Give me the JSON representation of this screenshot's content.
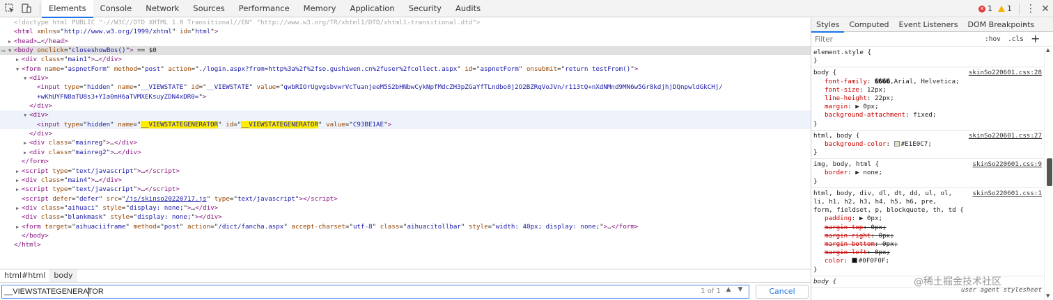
{
  "toolbar": {
    "tabs": [
      "Elements",
      "Console",
      "Network",
      "Sources",
      "Performance",
      "Memory",
      "Application",
      "Security",
      "Audits"
    ],
    "active_tab": "Elements",
    "error_count": "1",
    "warning_count": "1"
  },
  "dom_lines": [
    {
      "indent": 0,
      "tri": "",
      "html": "<span class='cm'>&lt;!doctype html PUBLIC \"-//W3C//DTD XHTML 1.0 Transitional//EN\" \"http://www.w3.org/TR/xhtml1/DTD/xhtml1-transitional.dtd\"&gt;</span>"
    },
    {
      "indent": 0,
      "tri": "",
      "html": "<span class='tn'>&lt;html</span> <span class='an'>xmlns</span>=\"<span class='av'>http://www.w3.org/1999/xhtml</span>\" <span class='an'>id</span>=\"<span class='av'>html</span>\"<span class='tn'>&gt;</span>"
    },
    {
      "indent": 0,
      "tri": "▶",
      "html": "<span class='tn'>&lt;head&gt;</span>…<span class='tn'>&lt;/head&gt;</span>"
    },
    {
      "indent": 0,
      "tri": "▼",
      "sel": true,
      "html": "<span class='tn'>&lt;body</span> <span class='an'>onclick</span>=\"<span class='av'>closeshowBos()</span>\"<span class='tn'>&gt;</span> == $0"
    },
    {
      "indent": 1,
      "tri": "▶",
      "html": "<span class='tn'>&lt;div</span> <span class='an'>class</span>=\"<span class='av'>main1</span>\"<span class='tn'>&gt;</span>…<span class='tn'>&lt;/div&gt;</span>"
    },
    {
      "indent": 1,
      "tri": "▼",
      "html": "<span class='tn'>&lt;form</span> <span class='an'>name</span>=\"<span class='av'>aspnetForm</span>\" <span class='an'>method</span>=\"<span class='av'>post</span>\" <span class='an'>action</span>=\"<span class='av'>./login.aspx?from=http%3a%2f%2fso.gushiwen.cn%2fuser%2fcollect.aspx</span>\" <span class='an'>id</span>=\"<span class='av'>aspnetForm</span>\" <span class='an'>onsubmit</span>=\"<span class='av'>return testFrom()</span>\"<span class='tn'>&gt;</span>"
    },
    {
      "indent": 2,
      "tri": "▼",
      "html": "<span class='tn'>&lt;div&gt;</span>"
    },
    {
      "indent": 3,
      "tri": "",
      "html": "<span class='tn'>&lt;input</span> <span class='an'>type</span>=\"<span class='av'>hidden</span>\" <span class='an'>name</span>=\"<span class='av'>__VIEWSTATE</span>\" <span class='an'>id</span>=\"<span class='av'>__VIEWSTATE</span>\" <span class='an'>value</span>=\"<span class='av'>qwbRIOrUgvgsbvwrVcTuanjeeM5S2bHNbwCykNpfMdcZH3pZGaYfTLndbo8j2O2BZRqVoJVn/r113tQ+nXdNMnd9MN6w5Gr8kdjhjDQnpwldGkCHj/</span>"
    },
    {
      "indent": 3,
      "tri": "",
      "html": "<span class='av'>+wKhUYFN8aTU8s3+YIa0nH6aTVMXEKsuyZDN4xDR0=</span>\"<span class='tn'>&gt;</span>"
    },
    {
      "indent": 2,
      "tri": "",
      "html": "<span class='tn'>&lt;/div&gt;</span>"
    },
    {
      "indent": 2,
      "tri": "▼",
      "hl": true,
      "html": "<span class='tn'>&lt;div&gt;</span>"
    },
    {
      "indent": 3,
      "tri": "",
      "hl": true,
      "html": "<span class='tn'>&lt;input</span> <span class='an'>type</span>=\"<span class='av'>hidden</span>\" <span class='an'>name</span>=\"<span class='av hlt'>__VIEWSTATEGENERATOR</span>\" <span class='an'>id</span>=\"<span class='av hlt'>__VIEWSTATEGENERATOR</span>\" <span class='an'>value</span>=\"<span class='av'>C93BE1AE</span>\"<span class='tn'>&gt;</span>"
    },
    {
      "indent": 2,
      "tri": "",
      "html": "<span class='tn'>&lt;/div&gt;</span>"
    },
    {
      "indent": 2,
      "tri": "▶",
      "html": "<span class='tn'>&lt;div</span> <span class='an'>class</span>=\"<span class='av'>mainreg</span>\"<span class='tn'>&gt;</span>…<span class='tn'>&lt;/div&gt;</span>"
    },
    {
      "indent": 2,
      "tri": "▶",
      "html": "<span class='tn'>&lt;div</span> <span class='an'>class</span>=\"<span class='av'>mainreg2</span>\"<span class='tn'>&gt;</span>…<span class='tn'>&lt;/div&gt;</span>"
    },
    {
      "indent": 1,
      "tri": "",
      "html": "<span class='tn'>&lt;/form&gt;</span>"
    },
    {
      "indent": 1,
      "tri": "▶",
      "html": "<span class='tn'>&lt;script</span> <span class='an'>type</span>=\"<span class='av'>text/javascript</span>\"<span class='tn'>&gt;</span>…<span class='tn'>&lt;/script&gt;</span>"
    },
    {
      "indent": 1,
      "tri": "▶",
      "html": "<span class='tn'>&lt;div</span> <span class='an'>class</span>=\"<span class='av'>main4</span>\"<span class='tn'>&gt;</span>…<span class='tn'>&lt;/div&gt;</span>"
    },
    {
      "indent": 1,
      "tri": "▶",
      "html": "<span class='tn'>&lt;script</span> <span class='an'>type</span>=\"<span class='av'>text/javascript</span>\"<span class='tn'>&gt;</span>…<span class='tn'>&lt;/script&gt;</span>"
    },
    {
      "indent": 1,
      "tri": "",
      "html": "<span class='tn'>&lt;script</span> <span class='an'>defer</span>=\"<span class='av'>defer</span>\" <span class='an'>src</span>=\"<span class='lnk'>/js/skinso20220717.js</span>\" <span class='an'>type</span>=\"<span class='av'>text/javascript</span>\"<span class='tn'>&gt;&lt;/script&gt;</span>"
    },
    {
      "indent": 1,
      "tri": "▶",
      "html": "<span class='tn'>&lt;div</span> <span class='an'>class</span>=\"<span class='av'>aihuaci</span>\" <span class='an'>style</span>=\"<span class='av'>display: none;</span>\"<span class='tn'>&gt;</span>…<span class='tn'>&lt;/div&gt;</span>"
    },
    {
      "indent": 1,
      "tri": "",
      "html": "<span class='tn'>&lt;div</span> <span class='an'>class</span>=\"<span class='av'>blankmask</span>\" <span class='an'>style</span>=\"<span class='av'>display: none;</span>\"<span class='tn'>&gt;&lt;/div&gt;</span>"
    },
    {
      "indent": 1,
      "tri": "▶",
      "html": "<span class='tn'>&lt;form</span> <span class='an'>target</span>=\"<span class='av'>aihuaciiframe</span>\" <span class='an'>method</span>=\"<span class='av'>post</span>\" <span class='an'>action</span>=\"<span class='av'>/dict/fancha.aspx</span>\" <span class='an'>accept-charset</span>=\"<span class='av'>utf-8</span>\" <span class='an'>class</span>=\"<span class='av'>aihuacitollbar</span>\" <span class='an'>style</span>=\"<span class='av'>width: 40px; display: none;</span>\"<span class='tn'>&gt;</span>…<span class='tn'>&lt;/form&gt;</span>"
    },
    {
      "indent": 1,
      "tri": "",
      "html": "<span class='tn'>&lt;/body&gt;</span>"
    },
    {
      "indent": 0,
      "tri": "",
      "html": "<span class='tn'>&lt;/html&gt;</span>"
    }
  ],
  "breadcrumbs": [
    "html#html",
    "body"
  ],
  "search": {
    "value": "__VIEWSTATEGENERATOR",
    "count": "1 of 1",
    "cancel_label": "Cancel"
  },
  "sidebar": {
    "tabs": [
      "Styles",
      "Computed",
      "Event Listeners",
      "DOM Breakpoints"
    ],
    "active_tab": "Styles",
    "filter_placeholder": "Filter",
    "hov_label": ":hov",
    "cls_label": ".cls",
    "add_label": "+"
  },
  "rules": [
    {
      "selector": "element.style {",
      "source": "",
      "props": [],
      "close": "}"
    },
    {
      "selector": "body {",
      "source": "skinSo220601.css:28",
      "props": [
        {
          "name": "font-family",
          "value": "����,Arial, Helvetica;"
        },
        {
          "name": "font-size",
          "value": "12px;"
        },
        {
          "name": "line-height",
          "value": "22px;"
        },
        {
          "name": "margin",
          "value": "▶ 0px;"
        },
        {
          "name": "background-attachment",
          "value": "fixed;"
        }
      ],
      "close": "}"
    },
    {
      "selector": "html, body {",
      "source": "skinSo220601.css:27",
      "props": [
        {
          "name": "background-color",
          "value": "#E1E0C7;",
          "swatch": "#E1E0C7"
        }
      ],
      "close": "}"
    },
    {
      "selector": "img, body, html {",
      "source": "skinSo220601.css:9",
      "props": [
        {
          "name": "border",
          "value": "▶ none;"
        }
      ],
      "close": "}"
    },
    {
      "selector": "html, body, div, dl, dt, dd, ul, ol,",
      "selector2": "li, h1, h2, h3, h4, h5, h6, pre,",
      "selector3": "form, fieldset, p, blockquote, th, td {",
      "source": "skinSo220601.css:1",
      "props": [
        {
          "name": "padding",
          "value": "▶ 0px;"
        },
        {
          "name": "margin-top",
          "value": "0px;",
          "strike": true
        },
        {
          "name": "margin-right",
          "value": "0px;",
          "strike": true
        },
        {
          "name": "margin-bottom",
          "value": "0px;",
          "strike": true
        },
        {
          "name": "margin-left",
          "value": "0px;",
          "strike": true
        },
        {
          "name": "color",
          "value": "#0F0F0F;",
          "swatch": "#0F0F0F"
        }
      ],
      "close": "}"
    },
    {
      "selector": "body {",
      "source": "user agent stylesheet",
      "ua": true,
      "props": [],
      "close": ""
    }
  ],
  "watermark": "@稀土掘金技术社区"
}
